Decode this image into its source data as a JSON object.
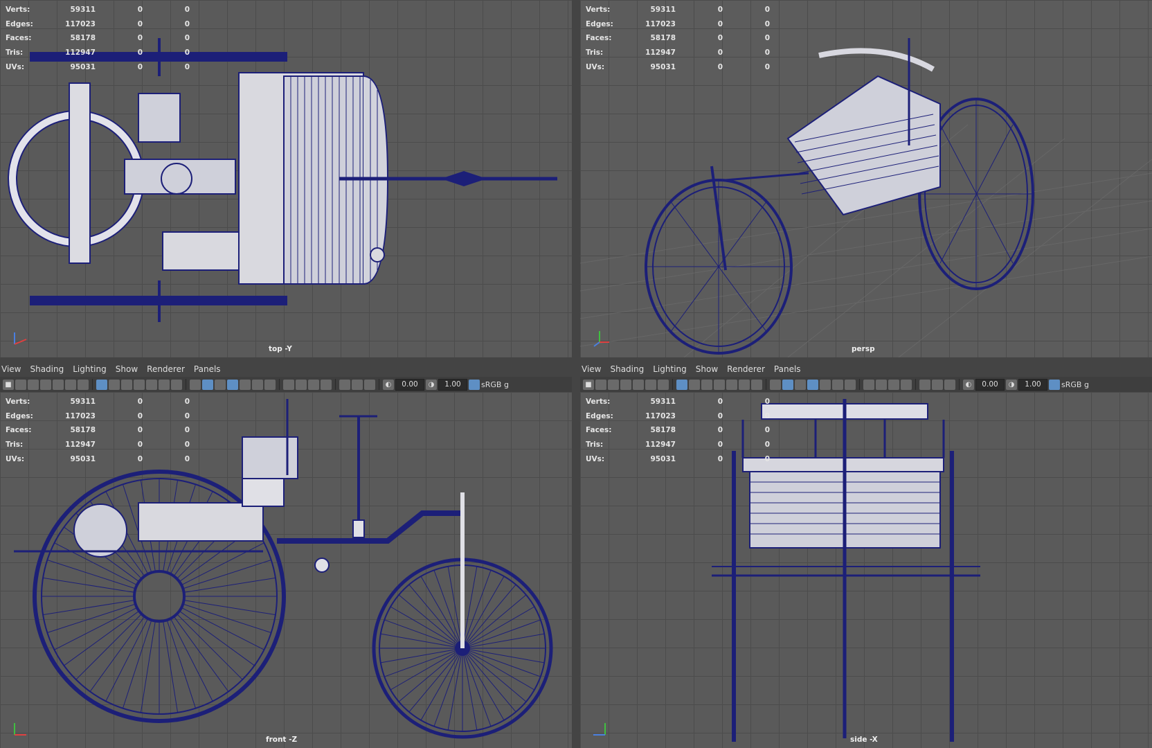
{
  "stats": {
    "rows": [
      {
        "label": "Verts:",
        "v1": "59311",
        "v2": "0",
        "v3": "0"
      },
      {
        "label": "Edges:",
        "v1": "117023",
        "v2": "0",
        "v3": "0"
      },
      {
        "label": "Faces:",
        "v1": "58178",
        "v2": "0",
        "v3": "0"
      },
      {
        "label": "Tris:",
        "v1": "112947",
        "v2": "0",
        "v3": "0"
      },
      {
        "label": "UVs:",
        "v1": "95031",
        "v2": "0",
        "v3": "0"
      }
    ]
  },
  "viewports": {
    "top_left": {
      "camera": "top -Y"
    },
    "top_right": {
      "camera": "persp"
    },
    "bottom_left": {
      "camera": "front -Z"
    },
    "bottom_right": {
      "camera": "side -X"
    }
  },
  "menu": {
    "items": [
      "View",
      "Shading",
      "Lighting",
      "Show",
      "Renderer",
      "Panels"
    ]
  },
  "toolbar": {
    "exposure": "0.00",
    "gamma": "1.00",
    "color_space": "sRGB g"
  },
  "colors": {
    "wire": "#1c1f78",
    "viewport_bg": "#5a5a5a",
    "grid": "#4c4c4c",
    "highlight": "#5e8fc4"
  }
}
